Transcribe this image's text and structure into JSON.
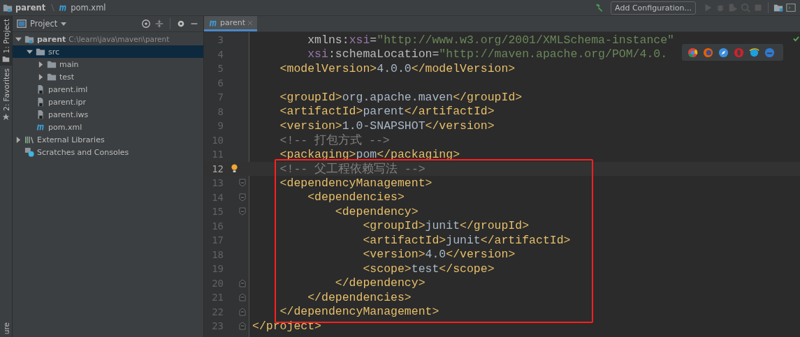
{
  "breadcrumb": [
    {
      "label": "parent",
      "kind": "folder"
    },
    {
      "label": "pom.xml",
      "kind": "maven"
    }
  ],
  "toolbar": {
    "run_config": "Add Configuration..."
  },
  "tool_stripe": [
    {
      "label": "1: Project",
      "kind": "folder",
      "selected": true
    },
    {
      "label": "2: Favorites",
      "kind": "star",
      "selected": false
    },
    {
      "label": "ure",
      "kind": "none",
      "selected": false
    }
  ],
  "project_panel": {
    "title": "Project",
    "tree": [
      {
        "label": "parent",
        "path": "C:\\learn\\java\\maven\\parent",
        "kind": "module",
        "expanded": true,
        "selected": false,
        "children": [
          {
            "label": "src",
            "kind": "folder",
            "expanded": true,
            "selected": true,
            "children": [
              {
                "label": "main",
                "kind": "folder",
                "expanded": false,
                "selected": false
              },
              {
                "label": "test",
                "kind": "folder",
                "expanded": false,
                "selected": false
              }
            ]
          },
          {
            "label": "parent.iml",
            "kind": "file",
            "selected": false
          },
          {
            "label": "parent.ipr",
            "kind": "file",
            "selected": false
          },
          {
            "label": "parent.iws",
            "kind": "file",
            "selected": false
          },
          {
            "label": "pom.xml",
            "kind": "maven",
            "selected": false
          }
        ]
      },
      {
        "label": "External Libraries",
        "kind": "libraries",
        "expanded": false,
        "selected": false
      },
      {
        "label": "Scratches and Consoles",
        "kind": "scratches",
        "selected": false
      }
    ]
  },
  "editor": {
    "tabs": [
      {
        "label": "parent",
        "selected": true
      }
    ],
    "lines": [
      {
        "number": "3",
        "tokens": [
          {
            "text": "        xmlns:",
            "kind": "attr"
          },
          {
            "text": "xsi",
            "kind": "ns"
          },
          {
            "text": "=",
            "kind": "attr"
          },
          {
            "text": "\"http://www.w3.org/2001/XMLSchema-instance\"",
            "kind": "value"
          }
        ]
      },
      {
        "number": "4",
        "tokens": [
          {
            "text": "        xsi",
            "kind": "ns"
          },
          {
            "text": ":schemaLocation=",
            "kind": "attr"
          },
          {
            "text": "\"http://maven.apache.org/POM/4.0.",
            "kind": "value"
          }
        ]
      },
      {
        "number": "5",
        "tokens": [
          {
            "text": "    <modelVersion>",
            "kind": "tag"
          },
          {
            "text": "4.0.0",
            "kind": "text"
          },
          {
            "text": "</modelVersion>",
            "kind": "tag"
          }
        ]
      },
      {
        "number": "6"
      },
      {
        "number": "7",
        "tokens": [
          {
            "text": "    <groupId>",
            "kind": "tag"
          },
          {
            "text": "org.apache.maven",
            "kind": "text"
          },
          {
            "text": "</groupId>",
            "kind": "tag"
          }
        ]
      },
      {
        "number": "8",
        "tokens": [
          {
            "text": "    <artifactId>",
            "kind": "tag"
          },
          {
            "text": "parent",
            "kind": "text"
          },
          {
            "text": "</artifactId>",
            "kind": "tag"
          }
        ]
      },
      {
        "number": "9",
        "tokens": [
          {
            "text": "    <version>",
            "kind": "tag"
          },
          {
            "text": "1.0-SNAPSHOT",
            "kind": "text"
          },
          {
            "text": "</version>",
            "kind": "tag"
          }
        ]
      },
      {
        "number": "10",
        "tokens": [
          {
            "text": "    <!-- 打包方式 -->",
            "kind": "comment"
          }
        ]
      },
      {
        "number": "11",
        "tokens": [
          {
            "text": "    <packaging>",
            "kind": "tag"
          },
          {
            "text": "pom",
            "kind": "text"
          },
          {
            "text": "</packaging>",
            "kind": "tag"
          }
        ]
      },
      {
        "number": "12",
        "current": true,
        "bulb": true,
        "tokens": [
          {
            "text": "    <!-- 父工程依赖写法 -->",
            "kind": "comment"
          }
        ]
      },
      {
        "number": "13",
        "fold_start": true,
        "tokens": [
          {
            "text": "    <dependencyManagement>",
            "kind": "tag"
          }
        ]
      },
      {
        "number": "14",
        "fold_start": true,
        "tokens": [
          {
            "text": "        <dependencies>",
            "kind": "tag"
          }
        ]
      },
      {
        "number": "15",
        "fold_start": true,
        "tokens": [
          {
            "text": "            <dependency>",
            "kind": "tag"
          }
        ]
      },
      {
        "number": "16",
        "tokens": [
          {
            "text": "                <groupId>",
            "kind": "tag"
          },
          {
            "text": "junit",
            "kind": "text"
          },
          {
            "text": "</groupId>",
            "kind": "tag"
          }
        ]
      },
      {
        "number": "17",
        "tokens": [
          {
            "text": "                <artifactId>",
            "kind": "tag"
          },
          {
            "text": "junit",
            "kind": "text"
          },
          {
            "text": "</artifactId>",
            "kind": "tag"
          }
        ]
      },
      {
        "number": "18",
        "tokens": [
          {
            "text": "                <version>",
            "kind": "tag"
          },
          {
            "text": "4.0",
            "kind": "text"
          },
          {
            "text": "</version>",
            "kind": "tag"
          }
        ]
      },
      {
        "number": "19",
        "tokens": [
          {
            "text": "                <scope>",
            "kind": "tag"
          },
          {
            "text": "test",
            "kind": "text"
          },
          {
            "text": "</scope>",
            "kind": "tag"
          }
        ]
      },
      {
        "number": "20",
        "fold_end": true,
        "tokens": [
          {
            "text": "            </dependency>",
            "kind": "tag"
          }
        ]
      },
      {
        "number": "21",
        "fold_end": true,
        "tokens": [
          {
            "text": "        </dependencies>",
            "kind": "tag"
          }
        ]
      },
      {
        "number": "22",
        "fold_end": true,
        "tokens": [
          {
            "text": "    </dependencyManagement>",
            "kind": "tag"
          }
        ]
      },
      {
        "number": "23",
        "fold_end": true,
        "tokens": [
          {
            "text": "</project>",
            "kind": "tag"
          }
        ]
      }
    ]
  }
}
